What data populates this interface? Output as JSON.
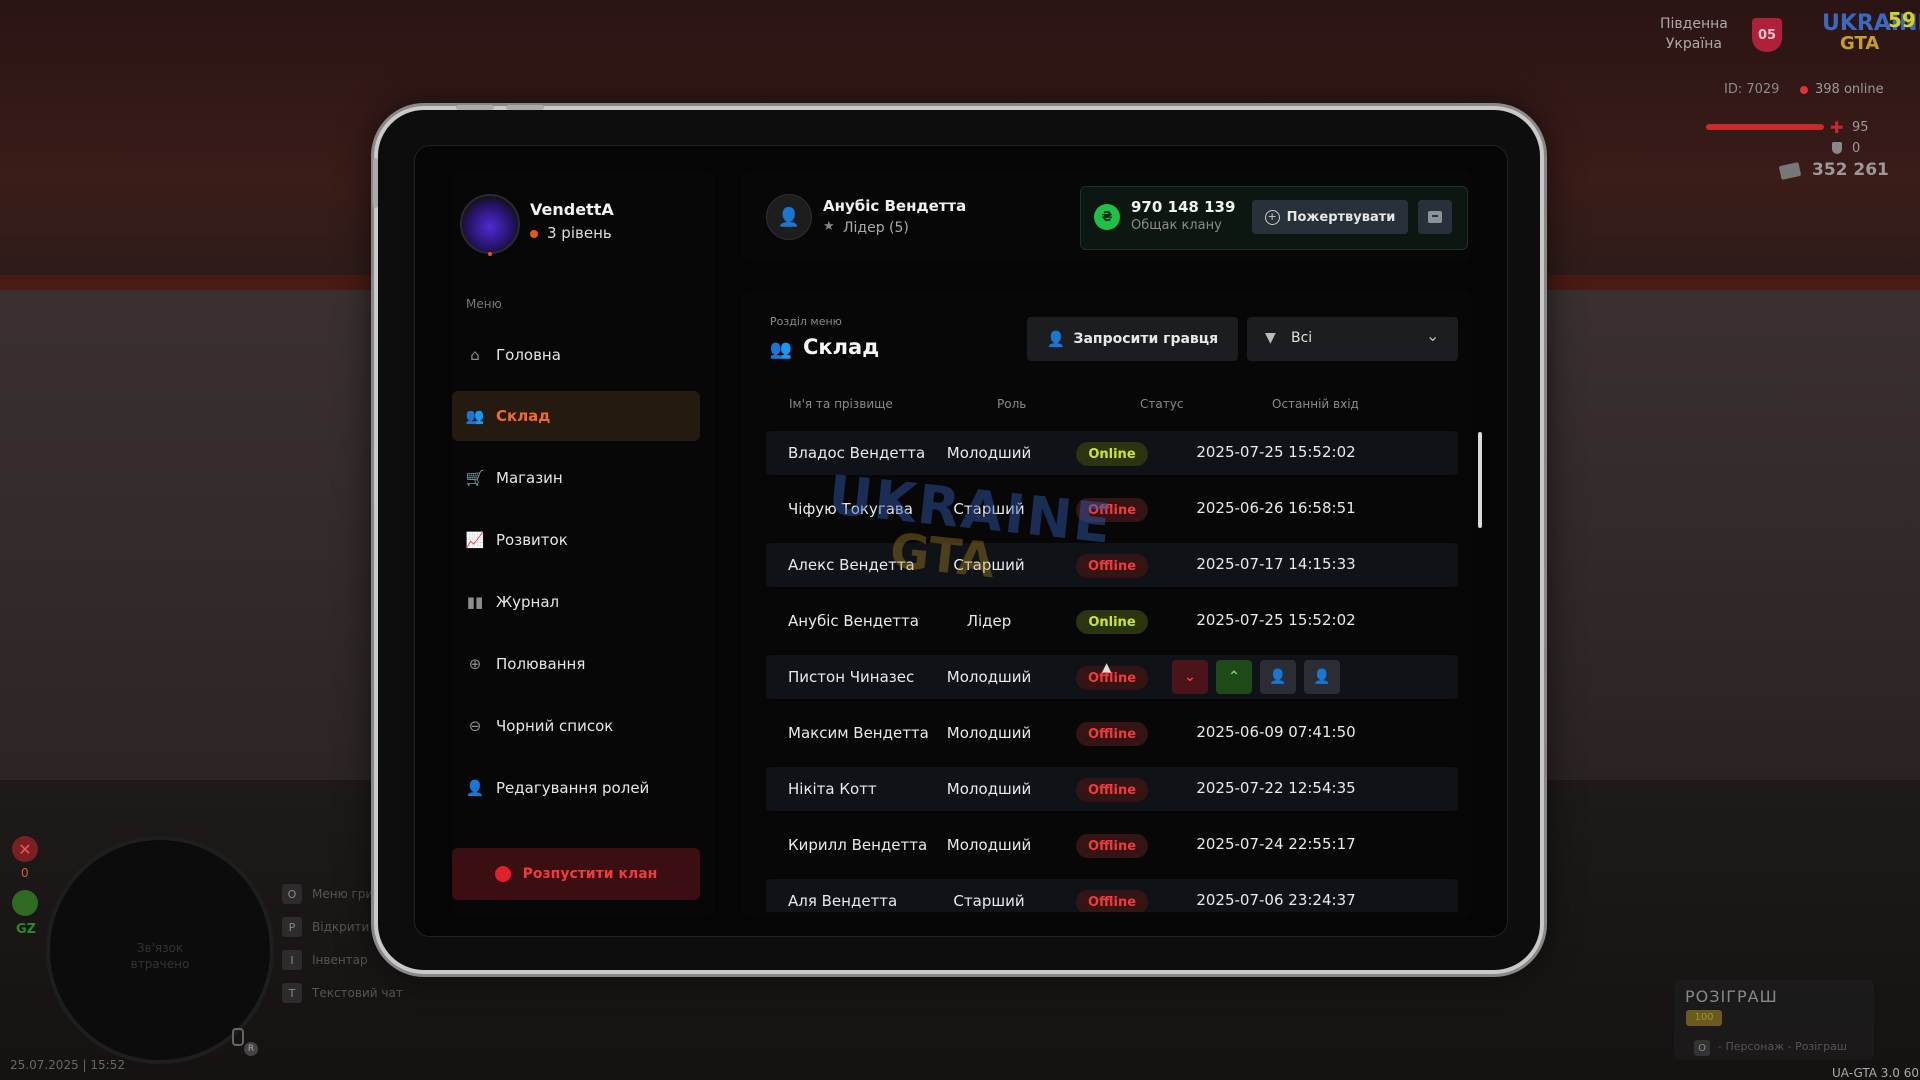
{
  "hud": {
    "region_line1": "Південна",
    "region_line2": "Україна",
    "region_badge": "05",
    "logo_top": "UKRAINE",
    "logo_bottom": "GTA",
    "fps": "59",
    "player_id": "ID: 7029",
    "online": "398 online",
    "health": "95",
    "armor": "0",
    "money": "352 261",
    "zero_counter": "0",
    "gz_label": "GZ",
    "radar_text": "Зв'язок втрачено",
    "keys": [
      {
        "key": "O",
        "label": "Меню гри"
      },
      {
        "key": "P",
        "label": "Відкрити"
      },
      {
        "key": "I",
        "label": "Інвентар"
      },
      {
        "key": "T",
        "label": "Текстовий чат"
      }
    ],
    "mic_badge": "R",
    "datetime": "25.07.2025 | 15:52",
    "version": "UA-GTA 3.0",
    "version_right": "60",
    "giveaway_title": "РОЗІГРАШ",
    "giveaway_badge": "100",
    "giveaway_key": "O",
    "giveaway_hint": "- Персонаж - Розіграш"
  },
  "sidebar": {
    "clan_name": "VendettA",
    "clan_level": "3 рівень",
    "menu_caption": "Меню",
    "items": [
      {
        "label": "Головна",
        "icon": "home-icon",
        "glyph": "⌂"
      },
      {
        "label": "Склад",
        "icon": "group-icon",
        "glyph": "👥"
      },
      {
        "label": "Магазин",
        "icon": "basket-icon",
        "glyph": "🛒"
      },
      {
        "label": "Розвиток",
        "icon": "chart-icon",
        "glyph": "📈"
      },
      {
        "label": "Журнал",
        "icon": "book-icon",
        "glyph": "▮▮"
      },
      {
        "label": "Полювання",
        "icon": "crosshair-icon",
        "glyph": "⊕"
      },
      {
        "label": "Чорний список",
        "icon": "block-icon",
        "glyph": "⊖"
      },
      {
        "label": "Редагування ролей",
        "icon": "user-edit-icon",
        "glyph": "👤"
      }
    ],
    "active_index": 1,
    "disband_label": "Розпустити клан"
  },
  "header": {
    "user_name": "Анубіс Вендетта",
    "user_role": "Лідер (5)",
    "bank_currency_glyph": "₴",
    "bank_amount": "970 148 139",
    "bank_caption": "Общак клану",
    "donate_label": "Пожертвувати"
  },
  "main": {
    "section_caption": "Розділ меню",
    "section_title": "Склад",
    "invite_label": "Запросити гравця",
    "filter_value": "Всі",
    "columns": [
      "Ім'я та прізвище",
      "Роль",
      "Статус",
      "Останній вхід"
    ],
    "rows": [
      {
        "name": "Владос Вендетта",
        "role": "Молодший",
        "status": "Online",
        "last": "2025-07-25 15:52:02"
      },
      {
        "name": "Чіфую Токугава",
        "role": "Старший",
        "status": "Offline",
        "last": "2025-06-26 16:58:51"
      },
      {
        "name": "Алекс Вендетта",
        "role": "Старший",
        "status": "Offline",
        "last": "2025-07-17 14:15:33"
      },
      {
        "name": "Анубіс Вендетта",
        "role": "Лідер",
        "status": "Online",
        "last": "2025-07-25 15:52:02"
      },
      {
        "name": "Пистон Чиназес",
        "role": "Молодший",
        "status": "Offline",
        "last": ""
      },
      {
        "name": "Максим Вендетта",
        "role": "Молодший",
        "status": "Offline",
        "last": "2025-06-09 07:41:50"
      },
      {
        "name": "Нікіта Котт",
        "role": "Молодший",
        "status": "Offline",
        "last": "2025-07-22 12:54:35"
      },
      {
        "name": "Кирилл Вендетта",
        "role": "Молодший",
        "status": "Offline",
        "last": "2025-07-24 22:55:17"
      },
      {
        "name": "Аля Вендетта",
        "role": "Старший",
        "status": "Offline",
        "last": "2025-07-06 23:24:37"
      }
    ],
    "hovered_row_index": 4,
    "row_actions": [
      {
        "name": "demote-button",
        "glyph": "⌄"
      },
      {
        "name": "promote-button",
        "glyph": "⌃"
      },
      {
        "name": "kick-member-button",
        "glyph": "👤"
      },
      {
        "name": "member-profile-button",
        "glyph": "👤"
      }
    ]
  },
  "watermark": {
    "line1": "UKRAINE",
    "line2": "GTA"
  },
  "colors": {
    "accent": "#f26a28",
    "online": "#c8e830",
    "offline": "#f23a3a",
    "bank_green": "#1ec04a",
    "danger": "#e0202a"
  }
}
